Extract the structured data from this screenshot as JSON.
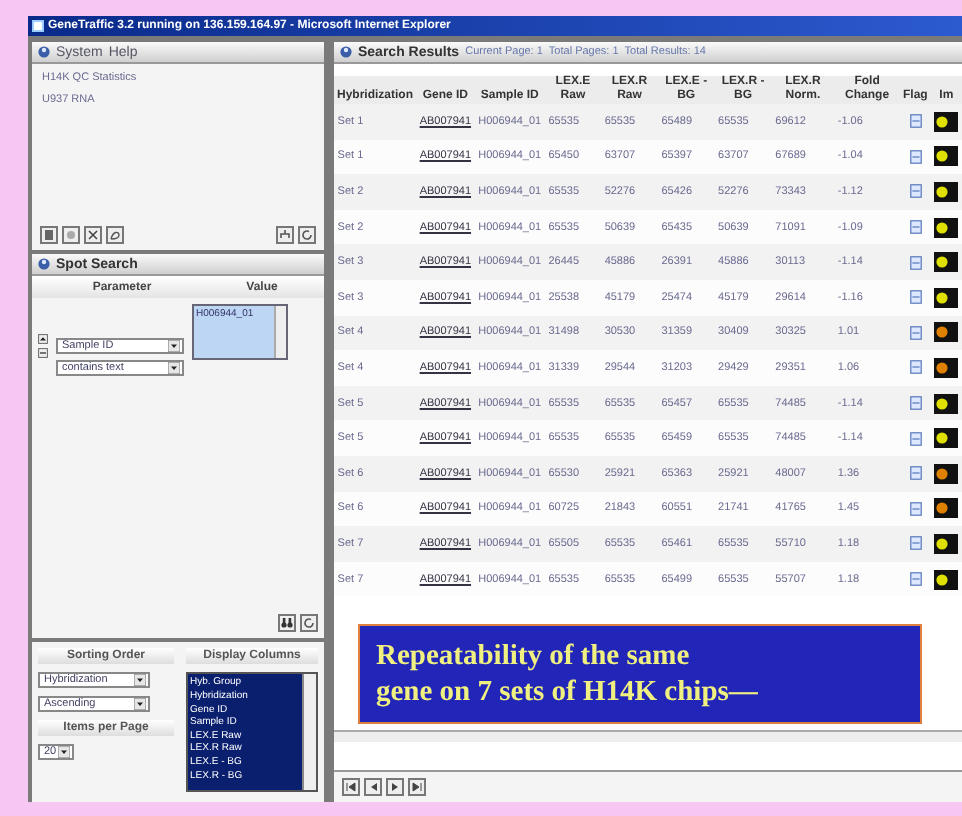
{
  "window": {
    "title": "GeneTraffic 3.2 running on 136.159.164.97 - Microsoft Internet Explorer"
  },
  "system_panel": {
    "menu": [
      "System",
      "Help"
    ],
    "items": [
      "H14K QC Statistics",
      "U937 RNA"
    ]
  },
  "spot_search": {
    "title": "Spot Search",
    "columns": [
      "Parameter",
      "Value"
    ],
    "parameter": "Sample ID",
    "operator": "contains text",
    "value": "H006944_01"
  },
  "sorting": {
    "title": "Sorting Order",
    "field": "Hybridization",
    "direction": "Ascending",
    "items_per_page_label": "Items per Page",
    "items_per_page": "20"
  },
  "display_columns": {
    "title": "Display Columns",
    "options": [
      {
        "label": "Hyb. Group",
        "selected": true
      },
      {
        "label": "Hybridization",
        "selected": true
      },
      {
        "label": "Gene ID",
        "selected": true
      },
      {
        "label": "Sample ID",
        "selected": true
      },
      {
        "label": "LEX.E Raw",
        "selected": true
      },
      {
        "label": "LEX.R Raw",
        "selected": true
      },
      {
        "label": "LEX.E - BG",
        "selected": true
      },
      {
        "label": "LEX.R - BG",
        "selected": true
      }
    ]
  },
  "results": {
    "title": "Search Results",
    "info": [
      "Current Page: 1",
      "Total Pages: 1",
      "Total Results: 14"
    ],
    "columns": [
      "Hybridization",
      "Gene ID",
      "Sample ID",
      "LEX.E Raw",
      "LEX.R Raw",
      "LEX.E - BG",
      "LEX.R - BG",
      "LEX.R Norm.",
      "Fold Change",
      "Flag",
      "Im"
    ],
    "rows": [
      {
        "hybridization": "Set 1",
        "gene_id": "AB007941",
        "sample_id": "H006944_01",
        "values": [
          "65535",
          "65535",
          "65489",
          "65535",
          "69612"
        ],
        "fold_change": "-1.06",
        "color": "#e0e000"
      },
      {
        "hybridization": "Set 1",
        "gene_id": "AB007941",
        "sample_id": "H006944_01",
        "values": [
          "65450",
          "63707",
          "65397",
          "63707",
          "67689"
        ],
        "fold_change": "-1.04",
        "color": "#e0e000"
      },
      {
        "hybridization": "Set 2",
        "gene_id": "AB007941",
        "sample_id": "H006944_01",
        "values": [
          "65535",
          "52276",
          "65426",
          "52276",
          "73343"
        ],
        "fold_change": "-1.12",
        "color": "#e0e000"
      },
      {
        "hybridization": "Set 2",
        "gene_id": "AB007941",
        "sample_id": "H006944_01",
        "values": [
          "65535",
          "50639",
          "65435",
          "50639",
          "71091"
        ],
        "fold_change": "-1.09",
        "color": "#e0e000"
      },
      {
        "hybridization": "Set 3",
        "gene_id": "AB007941",
        "sample_id": "H006944_01",
        "values": [
          "26445",
          "45886",
          "26391",
          "45886",
          "30113"
        ],
        "fold_change": "-1.14",
        "color": "#e0e000"
      },
      {
        "hybridization": "Set 3",
        "gene_id": "AB007941",
        "sample_id": "H006944_01",
        "values": [
          "25538",
          "45179",
          "25474",
          "45179",
          "29614"
        ],
        "fold_change": "-1.16",
        "color": "#e0e000"
      },
      {
        "hybridization": "Set 4",
        "gene_id": "AB007941",
        "sample_id": "H006944_01",
        "values": [
          "31498",
          "30530",
          "31359",
          "30409",
          "30325"
        ],
        "fold_change": "1.01",
        "color": "#e08000"
      },
      {
        "hybridization": "Set 4",
        "gene_id": "AB007941",
        "sample_id": "H006944_01",
        "values": [
          "31339",
          "29544",
          "31203",
          "29429",
          "29351"
        ],
        "fold_change": "1.06",
        "color": "#e08000"
      },
      {
        "hybridization": "Set 5",
        "gene_id": "AB007941",
        "sample_id": "H006944_01",
        "values": [
          "65535",
          "65535",
          "65457",
          "65535",
          "74485"
        ],
        "fold_change": "-1.14",
        "color": "#e0e000"
      },
      {
        "hybridization": "Set 5",
        "gene_id": "AB007941",
        "sample_id": "H006944_01",
        "values": [
          "65535",
          "65535",
          "65459",
          "65535",
          "74485"
        ],
        "fold_change": "-1.14",
        "color": "#e0e000"
      },
      {
        "hybridization": "Set 6",
        "gene_id": "AB007941",
        "sample_id": "H006944_01",
        "values": [
          "65530",
          "25921",
          "65363",
          "25921",
          "48007"
        ],
        "fold_change": "1.36",
        "color": "#e08000"
      },
      {
        "hybridization": "Set 6",
        "gene_id": "AB007941",
        "sample_id": "H006944_01",
        "values": [
          "60725",
          "21843",
          "60551",
          "21741",
          "41765"
        ],
        "fold_change": "1.45",
        "color": "#e08000"
      },
      {
        "hybridization": "Set 7",
        "gene_id": "AB007941",
        "sample_id": "H006944_01",
        "values": [
          "65505",
          "65535",
          "65461",
          "65535",
          "55710"
        ],
        "fold_change": "1.18",
        "color": "#e0e000"
      },
      {
        "hybridization": "Set 7",
        "gene_id": "AB007941",
        "sample_id": "H006944_01",
        "values": [
          "65535",
          "65535",
          "65499",
          "65535",
          "55707"
        ],
        "fold_change": "1.18",
        "color": "#e0e000"
      }
    ]
  },
  "caption": {
    "lines": [
      "Repeatability of the same",
      "gene on 7 sets of H14K chips—"
    ]
  }
}
